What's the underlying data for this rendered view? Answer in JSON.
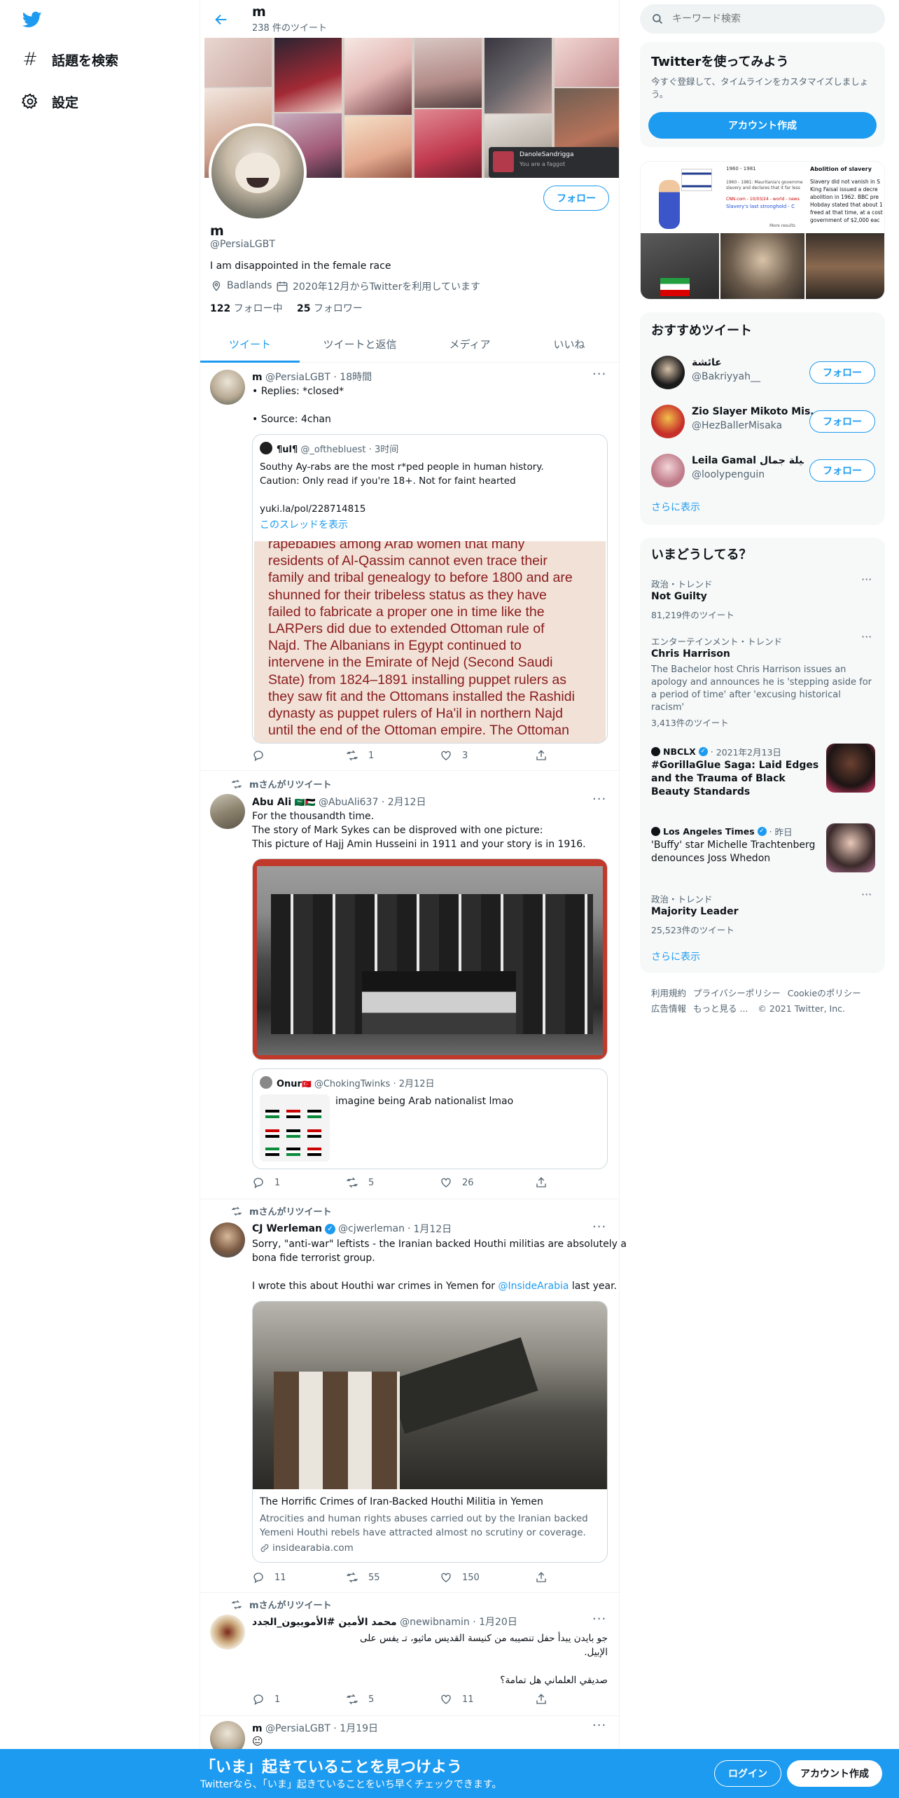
{
  "nav": {
    "explore": "話題を検索",
    "settings": "設定"
  },
  "header": {
    "name": "m",
    "tweet_count": "238 件のツイート"
  },
  "profile": {
    "name": "m",
    "handle": "@PersiaLGBT",
    "bio": "I am disappointed in the female race",
    "location": "Badlands",
    "joined": "2020年12月からTwitterを利用しています",
    "following_count": "122",
    "following_label": "フォロー中",
    "followers_count": "25",
    "followers_label": "フォロワー",
    "follow": "フォロー",
    "banner_card_name": "DanoleSandrigga",
    "banner_card_text": "You are a faggot"
  },
  "tabs": [
    "ツイート",
    "ツイートと返信",
    "メディア",
    "いいね"
  ],
  "tweets": [
    {
      "name": "m",
      "handle": "@PersiaLGBT",
      "time": "18時間",
      "lines": [
        "• Replies: *closed*",
        "",
        "• Source: 4chan"
      ],
      "quote": {
        "name": "¶ul¶",
        "handle": "@_ofthebluest",
        "time": "3时间",
        "lines": [
          "Southy Ay-rabs are the most r*ped people in human history.",
          "Caution: Only read if you're 18+. Not for faint hearted",
          "",
          "yuki.la/pol/228714815"
        ],
        "thread": "このスレッドを表示",
        "image_text": [
          "rapebabies among Arab women that many",
          "residents of Al-Qassim cannot even trace their",
          "family and tribal genealogy to before 1800 and are",
          "shunned for their tribeless status as they have",
          "failed to fabricate a proper one in time like the",
          "LARPers did due to extended Ottoman rule of",
          "Najd. The Albanians in Egypt continued to",
          "intervene in the Emirate of Nejd (Second Saudi",
          "State) from 1824–1891 installing puppet rulers as",
          "they saw fit and the Ottomans installed the Rashidi",
          "dynasty as puppet rulers of Ha'il in northern Najd",
          "until the end of the Ottoman empire. The Ottoman"
        ]
      },
      "replies": "",
      "retweets": "1",
      "likes": "3"
    },
    {
      "rt": "mさんがリツイート",
      "name": "Abu Ali",
      "flag": "🇸🇦🇵🇸",
      "handle": "@AbuAli637",
      "time": "2月12日",
      "lines": [
        "For the thousandth time.",
        "The story of Mark Sykes can be disproved with one picture:",
        "This picture of Hajj Amin Husseini in 1911 and your story is in 1916."
      ],
      "quote": {
        "name": "Onur",
        "flag": "🇹🇷",
        "handle": "@ChokingTwinks",
        "time": "2月12日",
        "text": "imagine being Arab nationalist lmao"
      },
      "replies": "1",
      "retweets": "5",
      "likes": "26"
    },
    {
      "rt": "mさんがリツイート",
      "name": "CJ Werleman",
      "handle": "@cjwerleman",
      "time": "1月12日",
      "lines": [
        "Sorry, \"anti-war\" leftists - the Iranian backed Houthi militias are absolutely a",
        "bona fide terrorist group."
      ],
      "line3_pre": "I wrote this about Houthi war crimes in Yemen for ",
      "line3_link": "@InsideArabia",
      "line3_post": " last year.",
      "card": {
        "title": "The Horrific Crimes of Iran-Backed Houthi Militia in Yemen",
        "desc": "Atrocities and human rights abuses carried out by the Iranian backed Yemeni Houthi rebels have attracted almost no scrutiny or coverage.",
        "domain": "insidearabia.com"
      },
      "replies": "11",
      "retweets": "55",
      "likes": "150"
    },
    {
      "rt": "mさんがリツイート",
      "name": "محمد الأمين #الأموييون_الجدد",
      "handle": "@newibnamin",
      "time": "1月20日",
      "lines": [
        "جو بايدن يبدأ حفل تنصيبه من كنيسة القديس ماثيو، تـ يفس على",
        "الإبيل.",
        "",
        "صديقي العلماني هل تمامة؟"
      ],
      "replies": "1",
      "retweets": "5",
      "likes": "11"
    },
    {
      "name": "m",
      "handle": "@PersiaLGBT",
      "time": "1月19日",
      "text": "😐"
    }
  ],
  "search": {
    "placeholder": "キーワード検索"
  },
  "signup": {
    "title": "Twitterを使ってみよう",
    "text": "今すぐ登録して、タイムラインをカスタマイズしましょう。",
    "button": "アカウント作成"
  },
  "recommended": {
    "title": "おすすめツイート",
    "users": [
      {
        "name": "عائشة",
        "handle": "@Bakriyyah__"
      },
      {
        "name": "Zio Slayer Mikoto Mis...",
        "handle": "@HezBallerMisaka"
      },
      {
        "name": "Leila Gamal ليلة جمال",
        "handle": "@loolypenguin"
      }
    ],
    "follow": "フォロー",
    "more": "さらに表示"
  },
  "media_panel": {
    "dates": "1960 - 1981",
    "caption_title": "Abolition of slavery",
    "caption_lines": [
      "Slavery did not vanish in S",
      "King Faisal issued a decre",
      "abolition in 1962. BBC pre",
      "Hobday stated that about 1",
      "freed at that time, at a cost",
      "government of $2,000 eac"
    ],
    "mid_lines": [
      "1960 - 1981: Mauritania's governme",
      "slavery and declares that it far less",
      "CNN.com - 10/03/24 - world - news",
      "Slavery's last stronghold - C"
    ],
    "more_results": "More results"
  },
  "trends": {
    "title": "いまどうしてる？",
    "items": [
      {
        "meta": "政治・トレンド",
        "name": "Not Guilty",
        "count": "81,219件のツイート"
      },
      {
        "meta": "エンターテインメント・トレンド",
        "name": "Chris Harrison",
        "desc": "The Bachelor host Chris Harrison issues an apology and announces he is 'stepping aside for a period of time' after 'excusing historical racism'",
        "count": "3,413件のツイート"
      },
      {
        "source": "NBCLX",
        "time": "2021年2月13日",
        "name_bold": "#GorillaGlue",
        "name": " Saga: Laid Edges and the Trauma of Black Beauty Standards"
      },
      {
        "source": "Los Angeles Times",
        "time": "昨日",
        "name": "'Buffy' star Michelle Trachtenberg denounces Joss Whedon"
      },
      {
        "meta": "政治・トレンド",
        "name": "Majority Leader",
        "count": "25,523件のツイート"
      }
    ],
    "more": "さらに表示"
  },
  "footer": {
    "links": [
      "利用規約",
      "プライバシーポリシー",
      "Cookieのポリシー",
      "広告情報",
      "もっと見る ..."
    ],
    "copyright": "© 2021 Twitter, Inc."
  },
  "bottom_bar": {
    "title": "「いま」起きていることを見つけよう",
    "subtitle": "Twitterなら、「いま」起きていることをいち早くチェックできます。",
    "login": "ログイン",
    "signup": "アカウント作成"
  },
  "colors": {
    "accent": "#1d9bf0",
    "text": "#0f1419",
    "muted": "#536471",
    "border": "#eff3f4"
  }
}
